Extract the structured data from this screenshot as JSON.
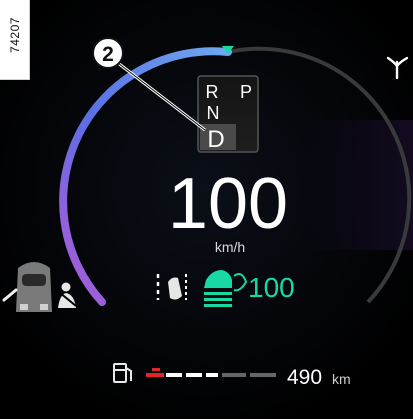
{
  "image_ref": "74207",
  "callout_number": "2",
  "gear_selector": {
    "gears_top": [
      "R",
      "P"
    ],
    "gear_mid": "N",
    "gear_selected": "D"
  },
  "speed": {
    "value": "100",
    "unit": "km/h"
  },
  "driver_assist": {
    "set_speed": "100"
  },
  "range": {
    "value": "490",
    "unit": "km"
  },
  "colors": {
    "background": "#000000",
    "arc_blue": "#4f87e0",
    "arc_purple": "#a05ad8",
    "active_green": "#16d9a4",
    "fuel_red": "#e0242a",
    "text_white": "#ffffff",
    "gear_highlight": "#4a4a4a"
  },
  "icons": [
    "navigation-marker-icon",
    "fork-road-icon",
    "car-door-open-icon",
    "seatbelt-warning-icon",
    "lane-departure-icon",
    "adaptive-cruise-icon",
    "fuel-pump-icon"
  ]
}
